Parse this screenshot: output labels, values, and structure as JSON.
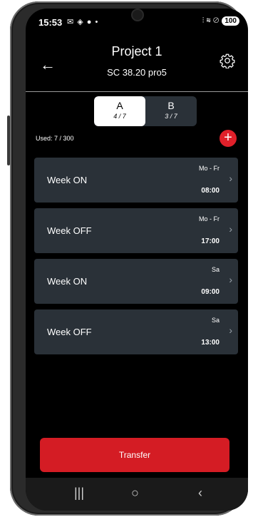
{
  "status_bar": {
    "time": "15:53",
    "left_icons": "✉ ◈ ● •",
    "right_icons": "⫶ ≋ ⊘",
    "battery": "100"
  },
  "header": {
    "back_icon": "←",
    "title": "Project 1",
    "subtitle": "SC 38.20 pro5"
  },
  "segments": [
    {
      "label": "A",
      "count": "4 / 7",
      "active": true
    },
    {
      "label": "B",
      "count": "3 / 7",
      "active": false
    }
  ],
  "used_text": "Used: 7 / 300",
  "add_icon": "+",
  "schedules": [
    {
      "name": "Week ON",
      "days": "Mo - Fr",
      "time": "08:00"
    },
    {
      "name": "Week OFF",
      "days": "Mo - Fr",
      "time": "17:00"
    },
    {
      "name": "Week ON",
      "days": "Sa",
      "time": "09:00"
    },
    {
      "name": "Week OFF",
      "days": "Sa",
      "time": "13:00"
    }
  ],
  "chevron": "›",
  "transfer_label": "Transfer",
  "nav": {
    "recents": "|||",
    "home": "○",
    "back": "‹"
  },
  "colors": {
    "accent_red": "#d41c24",
    "card_bg": "#2a3138",
    "screen_bg": "#000000"
  }
}
